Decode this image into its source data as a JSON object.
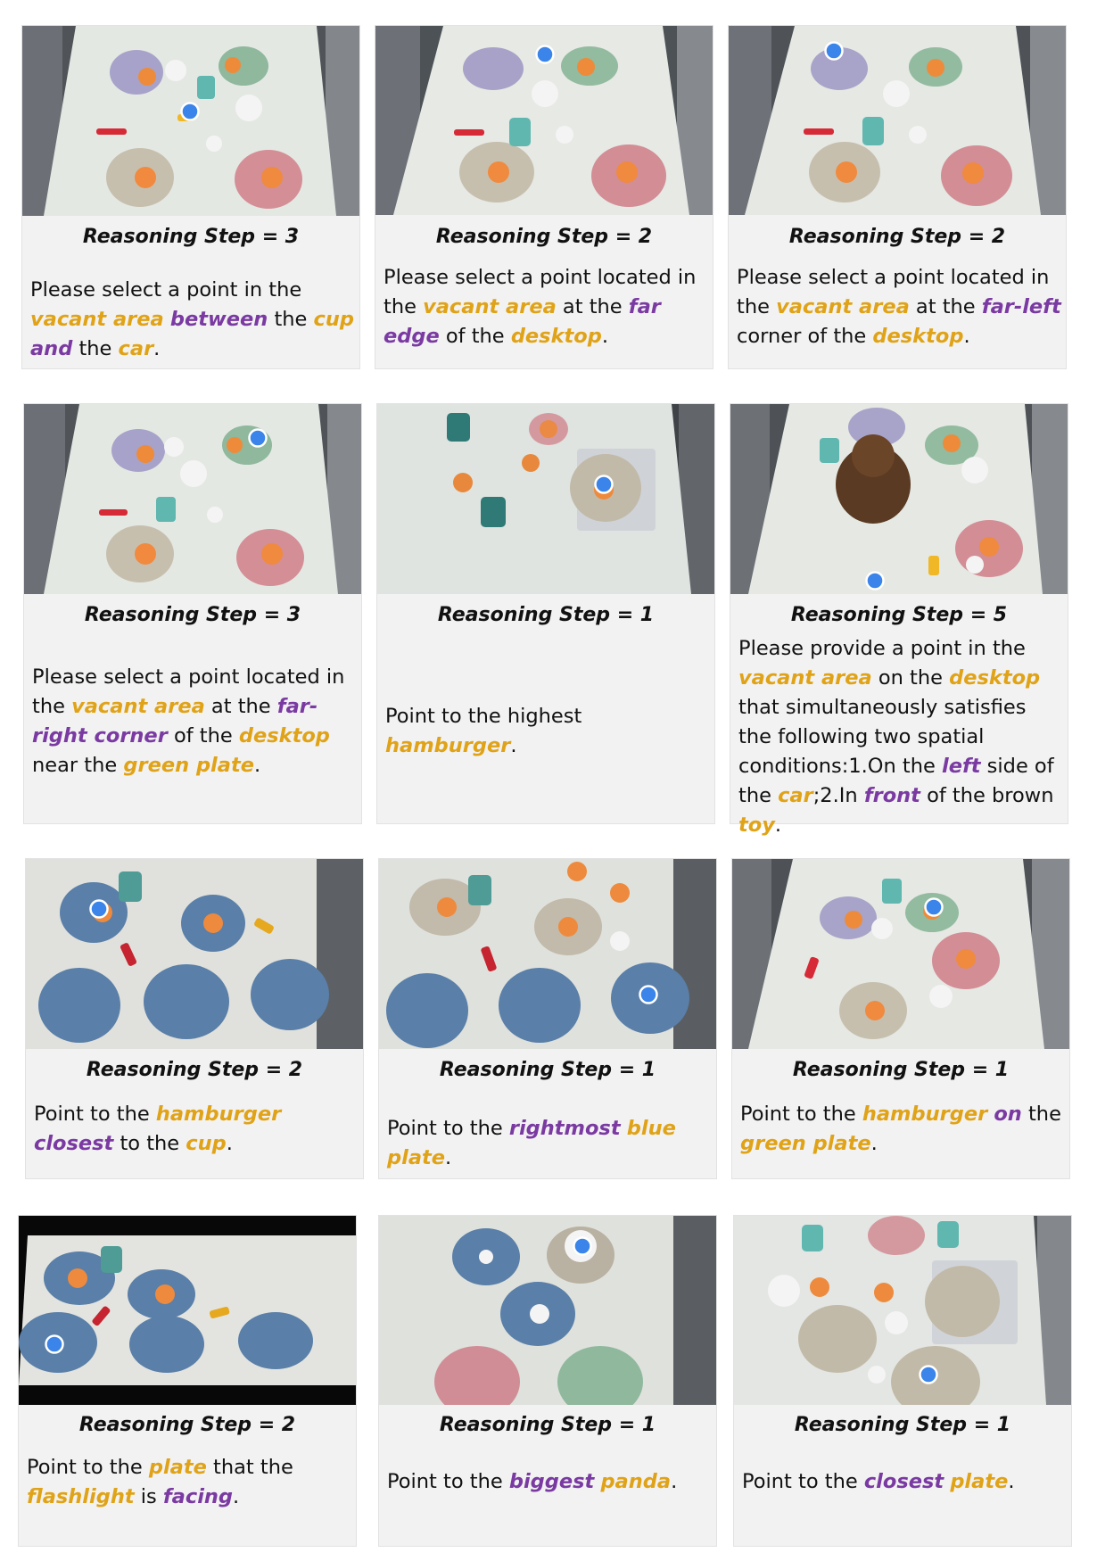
{
  "colors": {
    "accent_orange": "#e0a318",
    "accent_purple": "#7a3aa2",
    "marker_blue": "#3a84ea",
    "card_bg": "#f2f2f2"
  },
  "icons": [
    "point-marker-icon"
  ],
  "cards": [
    {
      "step": "Reasoning Step = 3",
      "segments": [
        {
          "t": "Please select a point in the "
        },
        {
          "t": "vacant area",
          "c": "or"
        },
        {
          "t": " "
        },
        {
          "t": "between",
          "c": "pu"
        },
        {
          "t": " the "
        },
        {
          "t": "cup",
          "c": "or"
        },
        {
          "t": " "
        },
        {
          "t": "and",
          "c": "pu"
        },
        {
          "t": " the "
        },
        {
          "t": "car",
          "c": "or"
        },
        {
          "t": "."
        }
      ]
    },
    {
      "step": "Reasoning Step = 2",
      "segments": [
        {
          "t": "Please select a point located in the "
        },
        {
          "t": "vacant area",
          "c": "or"
        },
        {
          "t": " at the "
        },
        {
          "t": "far edge",
          "c": "pu"
        },
        {
          "t": " of the "
        },
        {
          "t": "desktop",
          "c": "or"
        },
        {
          "t": "."
        }
      ]
    },
    {
      "step": "Reasoning Step = 2",
      "segments": [
        {
          "t": "Please select a point located in the "
        },
        {
          "t": "vacant area",
          "c": "or"
        },
        {
          "t": " at the "
        },
        {
          "t": "far-left",
          "c": "pu"
        },
        {
          "t": " corner of the "
        },
        {
          "t": "desktop",
          "c": "or"
        },
        {
          "t": "."
        }
      ]
    },
    {
      "step": "Reasoning Step = 3",
      "segments": [
        {
          "t": "Please select a point located in the "
        },
        {
          "t": "vacant area",
          "c": "or"
        },
        {
          "t": " at the  "
        },
        {
          "t": "far-right corner",
          "c": "pu"
        },
        {
          "t": " of the "
        },
        {
          "t": "desktop",
          "c": "or"
        },
        {
          "t": " near the "
        },
        {
          "t": "green plate",
          "c": "or"
        },
        {
          "t": "."
        }
      ]
    },
    {
      "step": "Reasoning Step = 1",
      "segments": [
        {
          "t": "Point to the highest "
        },
        {
          "t": "hamburger",
          "c": "or"
        },
        {
          "t": "."
        }
      ]
    },
    {
      "step": "Reasoning Step = 5",
      "segments": [
        {
          "t": "Please provide a point in the "
        },
        {
          "t": "vacant area",
          "c": "or"
        },
        {
          "t": " on the "
        },
        {
          "t": "desktop",
          "c": "or"
        },
        {
          "t": " that simultaneously satisfies the following two spatial conditions:1.On the "
        },
        {
          "t": "left",
          "c": "pu"
        },
        {
          "t": " side of the "
        },
        {
          "t": "car",
          "c": "or"
        },
        {
          "t": ";2.In "
        },
        {
          "t": "front",
          "c": "pu"
        },
        {
          "t": " of the brown "
        },
        {
          "t": "toy",
          "c": "or"
        },
        {
          "t": "."
        }
      ]
    },
    {
      "step": "Reasoning Step = 2",
      "segments": [
        {
          "t": "Point to the "
        },
        {
          "t": "hamburger",
          "c": "or"
        },
        {
          "t": " "
        },
        {
          "t": "closest",
          "c": "pu"
        },
        {
          "t": " to the "
        },
        {
          "t": "cup",
          "c": "or"
        },
        {
          "t": "."
        }
      ]
    },
    {
      "step": "Reasoning Step = 1",
      "segments": [
        {
          "t": "Point to the "
        },
        {
          "t": "rightmost",
          "c": "pu"
        },
        {
          "t": " "
        },
        {
          "t": "blue plate",
          "c": "or"
        },
        {
          "t": "."
        }
      ]
    },
    {
      "step": "Reasoning Step = 1",
      "segments": [
        {
          "t": "Point to the "
        },
        {
          "t": "hamburger",
          "c": "or"
        },
        {
          "t": " "
        },
        {
          "t": "on",
          "c": "pu"
        },
        {
          "t": " the "
        },
        {
          "t": "green plate",
          "c": "or"
        },
        {
          "t": "."
        }
      ]
    },
    {
      "step": "Reasoning Step = 2",
      "segments": [
        {
          "t": "Point to the "
        },
        {
          "t": "plate",
          "c": "or"
        },
        {
          "t": " that the "
        },
        {
          "t": "flashlight",
          "c": "or"
        },
        {
          "t": " is "
        },
        {
          "t": "facing",
          "c": "pu"
        },
        {
          "t": "."
        }
      ]
    },
    {
      "step": "Reasoning Step = 1",
      "segments": [
        {
          "t": "Point to the "
        },
        {
          "t": "biggest",
          "c": "pu"
        },
        {
          "t": " "
        },
        {
          "t": "panda",
          "c": "or"
        },
        {
          "t": "."
        }
      ]
    },
    {
      "step": "Reasoning Step = 1",
      "segments": [
        {
          "t": "Point to the "
        },
        {
          "t": "closest",
          "c": "pu"
        },
        {
          "t": " "
        },
        {
          "t": "plate",
          "c": "or"
        },
        {
          "t": "."
        }
      ]
    }
  ]
}
